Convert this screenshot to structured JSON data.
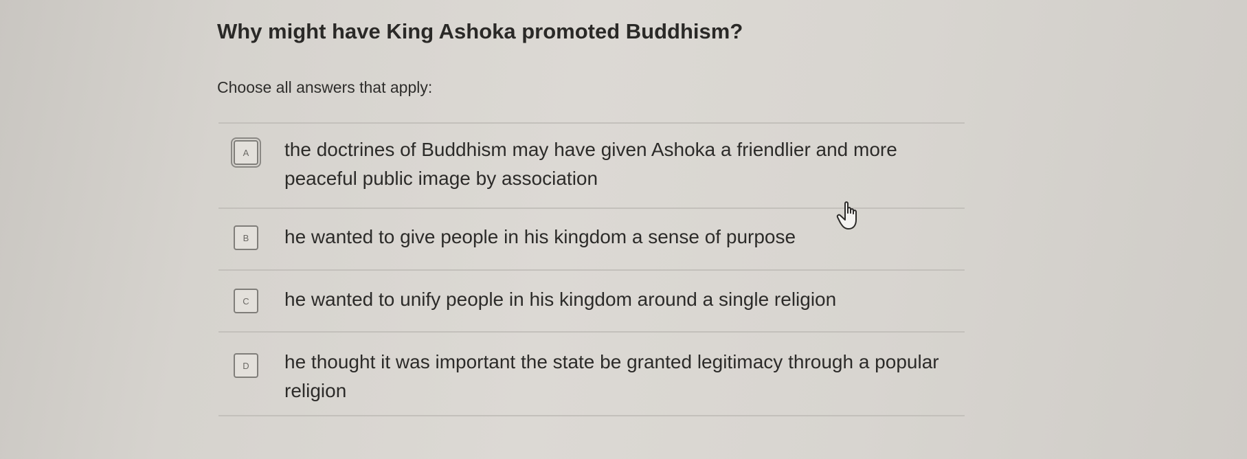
{
  "question": "Why might have King Ashoka promoted Buddhism?",
  "instruction": "Choose all answers that apply:",
  "choices": [
    {
      "letter": "A",
      "text": "the doctrines of Buddhism may have given Ashoka a friendlier and more peaceful public image by association"
    },
    {
      "letter": "B",
      "text": "he wanted to give people in his kingdom a sense of purpose"
    },
    {
      "letter": "C",
      "text": "he wanted to unify people in his kingdom around a single religion"
    },
    {
      "letter": "D",
      "text": "he thought it was important the state be granted legitimacy through a popular religion"
    }
  ],
  "icons": {
    "cursor": "hand-pointer-icon"
  }
}
